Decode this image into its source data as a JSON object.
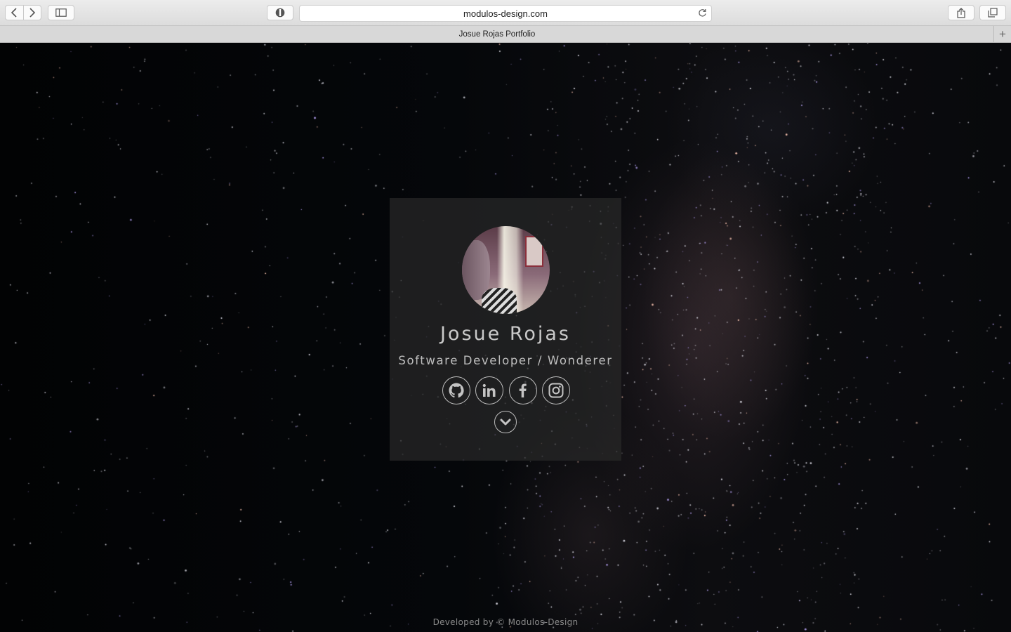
{
  "browser": {
    "url": "modulos-design.com",
    "tab_title": "Josue Rojas Portfolio",
    "new_tab_label": "+"
  },
  "profile": {
    "name": "Josue Rojas",
    "subtitle": "Software Developer / Wonderer"
  },
  "socials": [
    {
      "icon": "github-icon"
    },
    {
      "icon": "linkedin-icon"
    },
    {
      "icon": "facebook-icon"
    },
    {
      "icon": "instagram-icon"
    }
  ],
  "footer": {
    "text": "Developed by © Modulos-Design"
  },
  "colors": {
    "background": "#000000",
    "card": "#282828",
    "text": "#c9c9c9"
  }
}
